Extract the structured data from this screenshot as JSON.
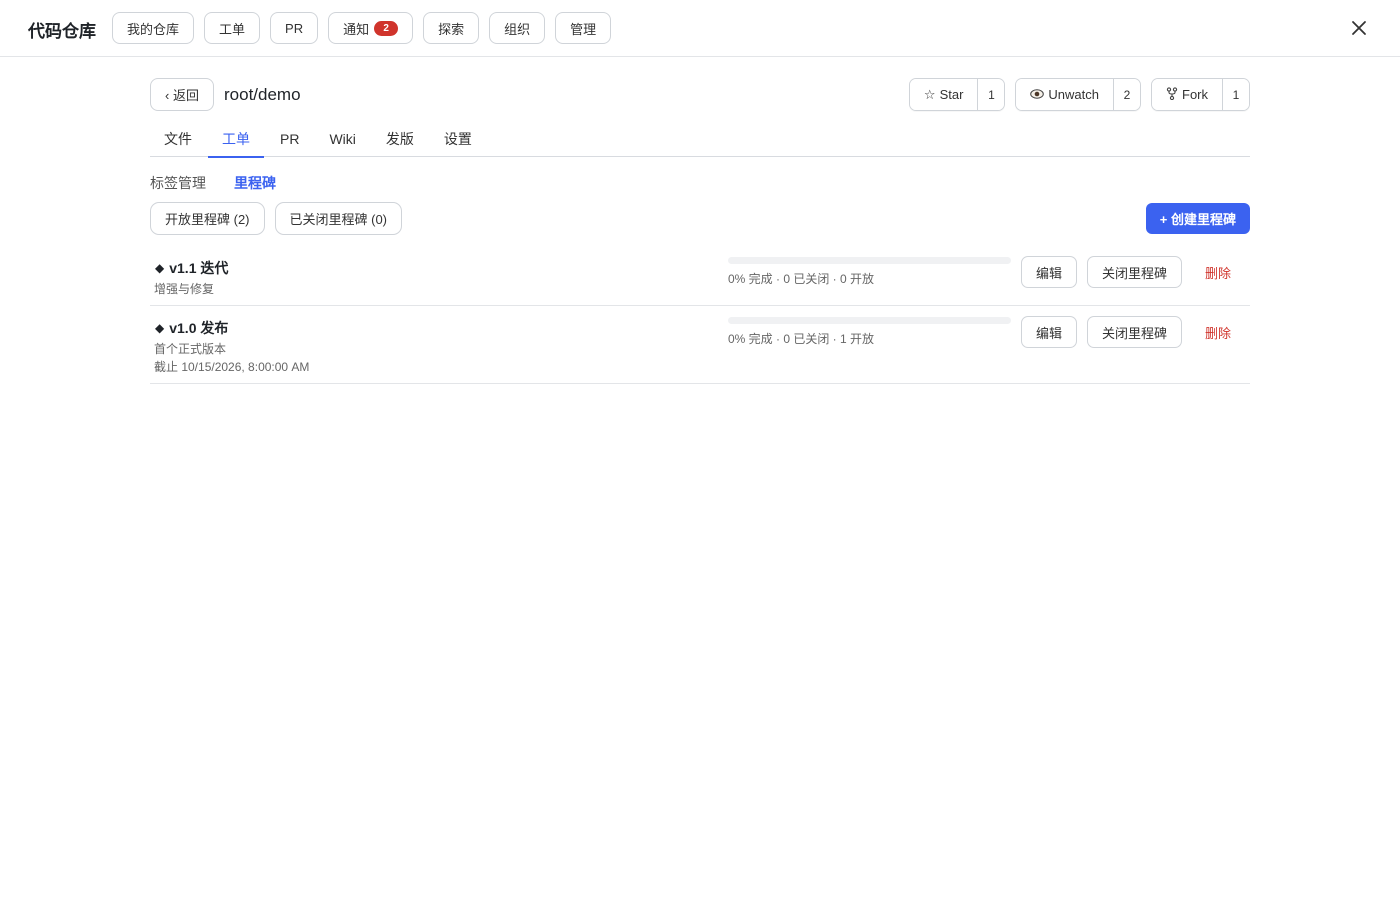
{
  "app": {
    "brand": "代码仓库"
  },
  "topnav": {
    "items": [
      {
        "label": "我的仓库"
      },
      {
        "label": "工单"
      },
      {
        "label": "PR"
      },
      {
        "label": "通知",
        "badge": "2"
      },
      {
        "label": "探索"
      },
      {
        "label": "组织"
      },
      {
        "label": "管理"
      }
    ]
  },
  "repo": {
    "back_label": "‹ 返回",
    "name": "root/demo",
    "star": {
      "label": "Star",
      "count": "1"
    },
    "watch": {
      "label": "Unwatch",
      "count": "2"
    },
    "fork": {
      "label": "Fork",
      "count": "1"
    }
  },
  "tabs": [
    {
      "label": "文件"
    },
    {
      "label": "工单",
      "active": true
    },
    {
      "label": "PR"
    },
    {
      "label": "Wiki"
    },
    {
      "label": "发版"
    },
    {
      "label": "设置"
    }
  ],
  "subnav": {
    "labels": "标签管理",
    "milestones": "里程碑"
  },
  "filters": {
    "open": "开放里程碑 (2)",
    "closed": "已关闭里程碑 (0)"
  },
  "create_label": "+ 创建里程碑",
  "milestones": [
    {
      "title": "v1.1 迭代",
      "description": "增强与修复",
      "progress_percent": 0,
      "stats": "0% 完成 · 0 已关闭 · 0 开放",
      "edit_label": "编辑",
      "close_label": "关闭里程碑",
      "delete_label": "删除"
    },
    {
      "title": "v1.0 发布",
      "description": "首个正式版本",
      "due": "截止 10/15/2026, 8:00:00 AM",
      "progress_percent": 0,
      "stats": "0% 完成 · 0 已关闭 · 1 开放",
      "edit_label": "编辑",
      "close_label": "关闭里程碑",
      "delete_label": "删除"
    }
  ],
  "colors": {
    "accent": "#3b62f0",
    "danger": "#d0342c",
    "badge": "#d0342c"
  }
}
